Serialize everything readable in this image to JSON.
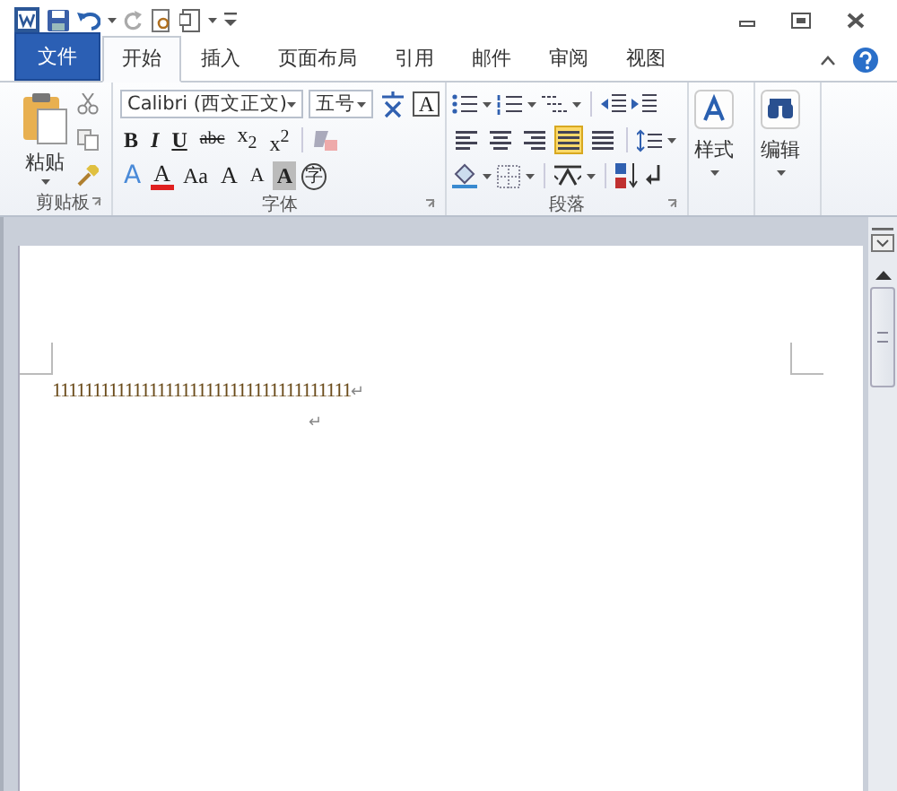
{
  "tabs": [
    {
      "label": "文件",
      "kind": "file",
      "selected": false
    },
    {
      "label": "开始",
      "kind": "tab",
      "selected": true
    },
    {
      "label": "插入",
      "kind": "tab",
      "selected": false
    },
    {
      "label": "页面布局",
      "kind": "tab",
      "selected": false
    },
    {
      "label": "引用",
      "kind": "tab",
      "selected": false
    },
    {
      "label": "邮件",
      "kind": "tab",
      "selected": false
    },
    {
      "label": "审阅",
      "kind": "tab",
      "selected": false
    },
    {
      "label": "视图",
      "kind": "tab",
      "selected": false
    }
  ],
  "clipboard": {
    "paste_label": "粘贴",
    "group_label": "剪贴板"
  },
  "font": {
    "font_name": "Calibri (西文正文)",
    "font_size": "五号",
    "box_letter": "A",
    "row2": [
      {
        "text": "B",
        "kind": "bold"
      },
      {
        "text": "I",
        "kind": "italic"
      },
      {
        "text": "U",
        "kind": "underline"
      },
      {
        "text": "abc",
        "kind": "strike"
      },
      {
        "text": "x$_{2}$",
        "kind": "sub"
      },
      {
        "text": "x$^{2}$",
        "kind": "sup"
      }
    ],
    "row3": [
      {
        "text": "A",
        "kind": "effect"
      },
      {
        "text": "A",
        "kind": "color"
      },
      {
        "text": "Aa",
        "kind": "case"
      },
      {
        "text": "A",
        "kind": "grow"
      },
      {
        "text": "A",
        "kind": "shrink"
      },
      {
        "text": "A",
        "kind": "shade"
      },
      {
        "text": "字",
        "kind": "enclose"
      }
    ],
    "group_label": "字体"
  },
  "paragraph": {
    "alignments": [
      {
        "selected": false
      },
      {
        "selected": false
      },
      {
        "selected": false
      },
      {
        "selected": true
      },
      {
        "selected": false
      }
    ],
    "group_label": "段落"
  },
  "styles": {
    "label": "样式"
  },
  "editing": {
    "label": "编辑"
  },
  "document": {
    "paragraphs": [
      {
        "text": "1111111111111111111111111111111111111",
        "mark": "↵",
        "kind": "normal"
      },
      {
        "mark": "↵",
        "kind": "indented"
      }
    ]
  }
}
